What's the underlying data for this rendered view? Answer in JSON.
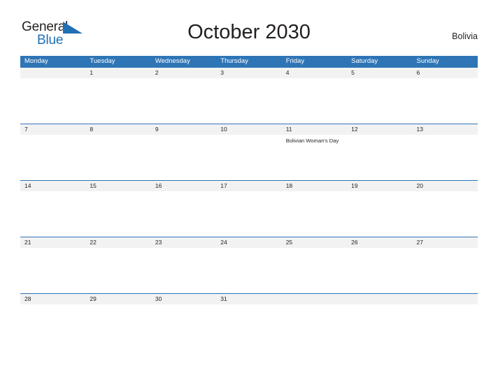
{
  "brand": {
    "name_part1": "General",
    "name_part2": "Blue",
    "flag_icon": "flag-triangle-icon",
    "accent_color": "#1f6fb4"
  },
  "header": {
    "title": "October 2030",
    "region": "Bolivia"
  },
  "theme": {
    "header_blue": "#2e75b6",
    "date_strip_gray": "#f2f2f2",
    "text_color": "#231f20",
    "page_background": "#ffffff"
  },
  "calendar": {
    "month": "October",
    "year": "2030",
    "weekday_headers": [
      "Monday",
      "Tuesday",
      "Wednesday",
      "Thursday",
      "Friday",
      "Saturday",
      "Sunday"
    ],
    "weeks": [
      {
        "days": [
          {
            "number": "",
            "events": []
          },
          {
            "number": "1",
            "events": []
          },
          {
            "number": "2",
            "events": []
          },
          {
            "number": "3",
            "events": []
          },
          {
            "number": "4",
            "events": []
          },
          {
            "number": "5",
            "events": []
          },
          {
            "number": "6",
            "events": []
          }
        ]
      },
      {
        "days": [
          {
            "number": "7",
            "events": []
          },
          {
            "number": "8",
            "events": []
          },
          {
            "number": "9",
            "events": []
          },
          {
            "number": "10",
            "events": []
          },
          {
            "number": "11",
            "events": [
              "Bolivian Woman's Day"
            ]
          },
          {
            "number": "12",
            "events": []
          },
          {
            "number": "13",
            "events": []
          }
        ]
      },
      {
        "days": [
          {
            "number": "14",
            "events": []
          },
          {
            "number": "15",
            "events": []
          },
          {
            "number": "16",
            "events": []
          },
          {
            "number": "17",
            "events": []
          },
          {
            "number": "18",
            "events": []
          },
          {
            "number": "19",
            "events": []
          },
          {
            "number": "20",
            "events": []
          }
        ]
      },
      {
        "days": [
          {
            "number": "21",
            "events": []
          },
          {
            "number": "22",
            "events": []
          },
          {
            "number": "23",
            "events": []
          },
          {
            "number": "24",
            "events": []
          },
          {
            "number": "25",
            "events": []
          },
          {
            "number": "26",
            "events": []
          },
          {
            "number": "27",
            "events": []
          }
        ]
      },
      {
        "days": [
          {
            "number": "28",
            "events": []
          },
          {
            "number": "29",
            "events": []
          },
          {
            "number": "30",
            "events": []
          },
          {
            "number": "31",
            "events": []
          },
          {
            "number": "",
            "events": []
          },
          {
            "number": "",
            "events": []
          },
          {
            "number": "",
            "events": []
          }
        ]
      }
    ]
  }
}
